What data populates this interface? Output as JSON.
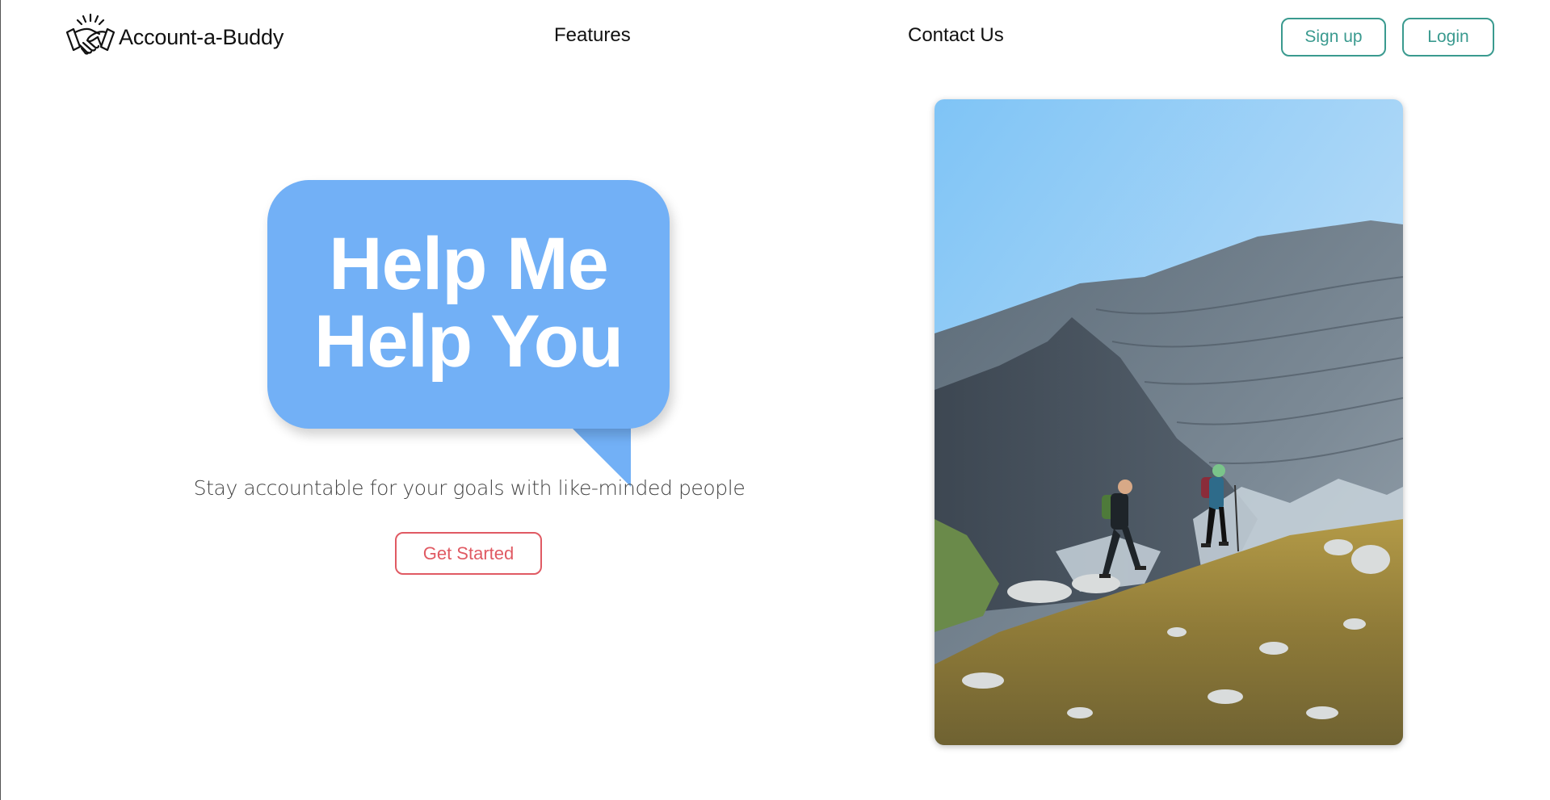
{
  "brand": {
    "name": "Account-a-Buddy",
    "logo_icon": "handshake-icon"
  },
  "nav": {
    "features": "Features",
    "contact": "Contact Us"
  },
  "auth": {
    "signup_label": "Sign up",
    "login_label": "Login"
  },
  "hero": {
    "headline_line1": "Help Me",
    "headline_line2": "Help You",
    "tagline": "Stay accountable for your goals with like-minded people",
    "cta_label": "Get Started",
    "photo_subject": "two-hikers-mountain-photo"
  },
  "colors": {
    "bubble": "#72b0f6",
    "teal_accent": "#3a9a8f",
    "cta_red": "#e05a63"
  }
}
